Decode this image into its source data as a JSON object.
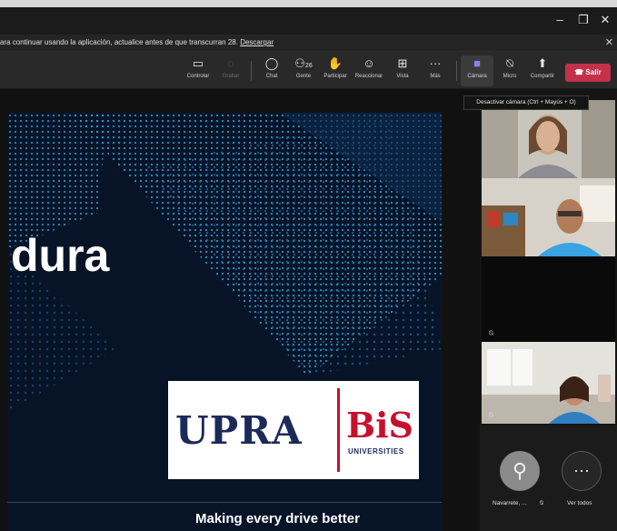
{
  "window": {
    "minimize": "–",
    "maximize": "❐",
    "close": "✕"
  },
  "banner": {
    "text": "ara continuar usando la aplicación, actualice antes de que transcurran 28.",
    "link": "Descargar",
    "close": "✕"
  },
  "toolbar": {
    "items": [
      {
        "label": "Controlar",
        "icon": "screen-share-icon"
      },
      {
        "label": "Grabar",
        "icon": "record-icon"
      },
      {
        "label": "Chat",
        "icon": "chat-icon"
      },
      {
        "label": "Gente",
        "icon": "people-icon",
        "count": "26"
      },
      {
        "label": "Participar",
        "icon": "raise-hand-icon"
      },
      {
        "label": "Reaccionar",
        "icon": "smile-icon"
      },
      {
        "label": "Vista",
        "icon": "grid-icon"
      },
      {
        "label": "Más",
        "icon": "more-icon"
      },
      {
        "label": "Cámara",
        "icon": "camera-icon"
      },
      {
        "label": "Micro",
        "icon": "mic-muted-icon"
      },
      {
        "label": "Compartir",
        "icon": "share-icon"
      }
    ],
    "leave_label": "Salir",
    "leave_color": "#c4314b"
  },
  "tooltip": "Desactivar cámara (Ctrl + Mayús + O)",
  "slide": {
    "heading": "dura",
    "logo_left": "UPRA",
    "logo_right": "BiS",
    "logo_sub": "UNIVERSITIES",
    "tagline": "Making every drive better"
  },
  "participants": {
    "bottom_name": "Navarrete, ...",
    "see_all": "Ver todos"
  }
}
